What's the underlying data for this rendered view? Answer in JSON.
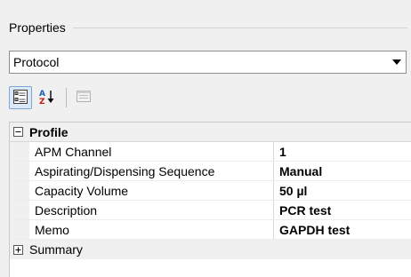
{
  "group": {
    "title": "Properties"
  },
  "object_selector": {
    "value": "Protocol"
  },
  "toolbar": {
    "buttons": [
      {
        "icon": "categorized-icon",
        "active": true
      },
      {
        "icon": "alphabetical-sort-icon",
        "active": false
      },
      {
        "icon": "property-pages-icon",
        "active": false
      }
    ]
  },
  "grid": {
    "category": {
      "label": "Profile",
      "expanded": true
    },
    "rows": [
      {
        "name": "APM Channel",
        "value": "1"
      },
      {
        "name": "Aspirating/Dispensing Sequence",
        "value": "Manual"
      },
      {
        "name": "Capacity Volume",
        "value": "50 µl"
      },
      {
        "name": "Description",
        "value": "PCR test"
      },
      {
        "name": "Memo",
        "value": "GAPDH test"
      }
    ],
    "collapsed_category": {
      "label": "Summary",
      "expanded": false
    }
  }
}
